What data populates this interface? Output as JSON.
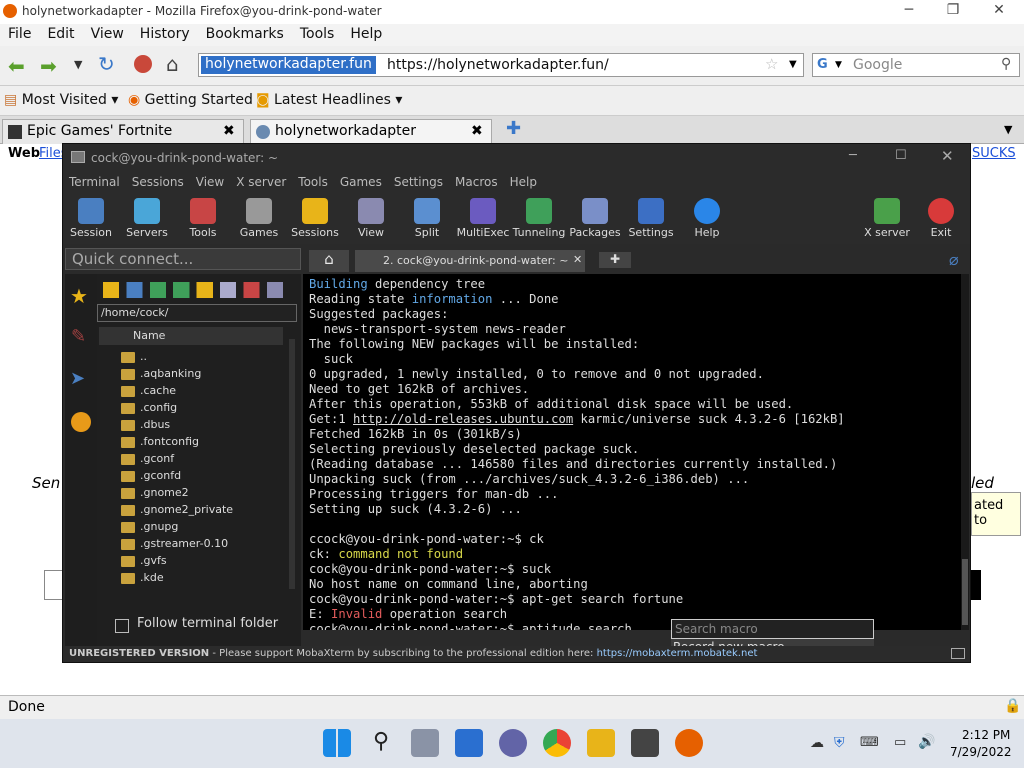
{
  "firefox": {
    "title": "holynetworkadapter - Mozilla Firefox@you-drink-pond-water",
    "menu": [
      "File",
      "Edit",
      "View",
      "History",
      "Bookmarks",
      "Tools",
      "Help"
    ],
    "url_host": "holynetworkadapter.fun",
    "url": "https://holynetworkadapter.fun/",
    "search_placeholder": "Google",
    "bookmarks": [
      "Most Visited",
      "Getting Started",
      "Latest Headlines"
    ],
    "tabs": [
      "Epic Games' Fortnite",
      "holynetworkadapter"
    ],
    "page_left": "Web",
    "page_link": "Files",
    "page_right": "SUCKS",
    "side_left": "Sen",
    "side_right": "led",
    "side_box": "ated to",
    "status": "Done"
  },
  "moba": {
    "title": "cock@you-drink-pond-water: ~",
    "menu": [
      "Terminal",
      "Sessions",
      "View",
      "X server",
      "Tools",
      "Games",
      "Settings",
      "Macros",
      "Help"
    ],
    "tools": [
      {
        "label": "Session"
      },
      {
        "label": "Servers"
      },
      {
        "label": "Tools"
      },
      {
        "label": "Games"
      },
      {
        "label": "Sessions"
      },
      {
        "label": "View"
      },
      {
        "label": "Split"
      },
      {
        "label": "MultiExec"
      },
      {
        "label": "Tunneling"
      },
      {
        "label": "Packages"
      },
      {
        "label": "Settings"
      },
      {
        "label": "Help"
      }
    ],
    "xserver": "X server",
    "exit": "Exit",
    "quick_connect": "Quick connect...",
    "path": "/home/cock/",
    "name_header": "Name",
    "files": [
      "..",
      ".aqbanking",
      ".cache",
      ".config",
      ".dbus",
      ".fontconfig",
      ".gconf",
      ".gconfd",
      ".gnome2",
      ".gnome2_private",
      ".gnupg",
      ".gstreamer-0.10",
      ".gvfs",
      ".kde"
    ],
    "follow": "Follow terminal folder",
    "term_tab": "2. cock@you-drink-pond-water: ~",
    "macro_placeholder": "Search macro",
    "record_macro": "Record new macro...",
    "unreg_label": "UNREGISTERED VERSION",
    "unreg_text": "- Please support MobaXterm by subscribing to the professional edition here:",
    "unreg_link": "https://mobaxterm.mobatek.net"
  },
  "taskbar": {
    "time": "2:12 PM",
    "date": "7/29/2022"
  }
}
